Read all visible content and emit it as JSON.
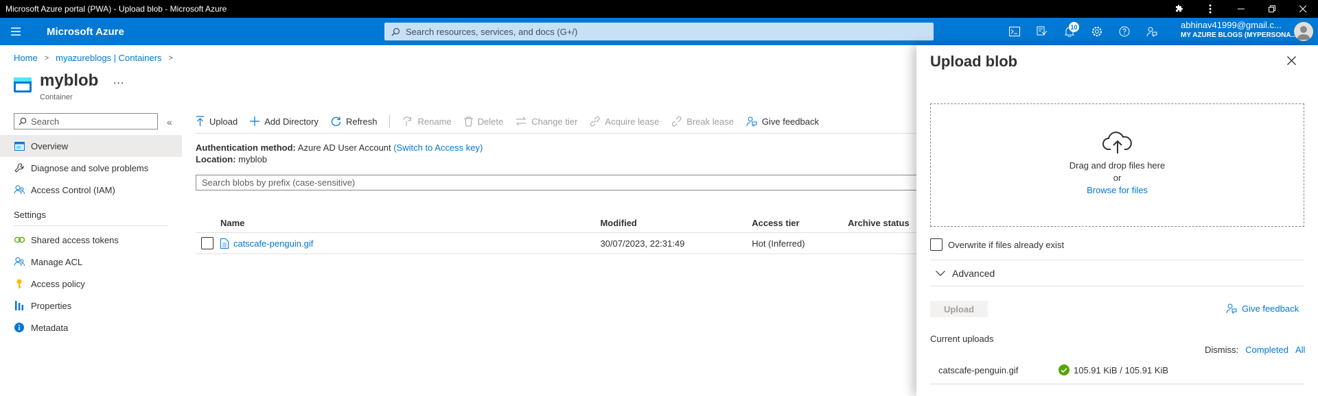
{
  "window": {
    "title": "Microsoft Azure portal (PWA) - Upload blob - Microsoft Azure"
  },
  "header": {
    "brand": "Microsoft Azure",
    "search_placeholder": "Search resources, services, and docs (G+/)",
    "notification_count": "10",
    "account_email": "abhinav41999@gmail.c...",
    "account_tenant": "MY AZURE BLOGS (MYPERSONA..."
  },
  "breadcrumb": {
    "items": [
      "Home",
      "myazureblogs | Containers"
    ]
  },
  "page": {
    "title": "myblob",
    "more": "...",
    "subtitle": "Container"
  },
  "nav": {
    "search_placeholder": "Search",
    "items": [
      {
        "label": "Overview",
        "icon": "overview-icon"
      },
      {
        "label": "Diagnose and solve problems",
        "icon": "wrench-icon"
      },
      {
        "label": "Access Control (IAM)",
        "icon": "people-icon"
      }
    ],
    "settings_label": "Settings",
    "settings_items": [
      {
        "label": "Shared access tokens",
        "icon": "link-icon"
      },
      {
        "label": "Manage ACL",
        "icon": "people-icon"
      },
      {
        "label": "Access policy",
        "icon": "key-icon"
      },
      {
        "label": "Properties",
        "icon": "properties-icon"
      },
      {
        "label": "Metadata",
        "icon": "info-icon"
      }
    ]
  },
  "toolbar": {
    "upload": "Upload",
    "add_directory": "Add Directory",
    "refresh": "Refresh",
    "rename": "Rename",
    "delete": "Delete",
    "change_tier": "Change tier",
    "acquire_lease": "Acquire lease",
    "break_lease": "Break lease",
    "give_feedback": "Give feedback"
  },
  "auth": {
    "method_label": "Authentication method:",
    "method_value": "Azure AD User Account",
    "switch_link": "(Switch to Access key)",
    "location_label": "Location:",
    "location_value": "myblob"
  },
  "blob_search_placeholder": "Search blobs by prefix (case-sensitive)",
  "table": {
    "headers": [
      "Name",
      "Modified",
      "Access tier",
      "Archive status"
    ],
    "rows": [
      {
        "name": "catscafe-penguin.gif",
        "modified": "30/07/2023, 22:31:49",
        "access_tier": "Hot (Inferred)",
        "archive_status": ""
      }
    ]
  },
  "panel": {
    "title": "Upload blob",
    "drag_text": "Drag and drop files here",
    "or_text": "or",
    "browse_text": "Browse for files",
    "overwrite_label": "Overwrite if files already exist",
    "advanced_label": "Advanced",
    "upload_button": "Upload",
    "give_feedback": "Give feedback",
    "current_uploads": "Current uploads",
    "dismiss_label": "Dismiss:",
    "dismiss_completed": "Completed",
    "dismiss_all": "All",
    "uploads": [
      {
        "name": "catscafe-penguin.gif",
        "progress": "105.91 KiB / 105.91 KiB"
      }
    ]
  },
  "colors": {
    "azure_blue": "#0078d4",
    "success_green": "#57a300"
  }
}
